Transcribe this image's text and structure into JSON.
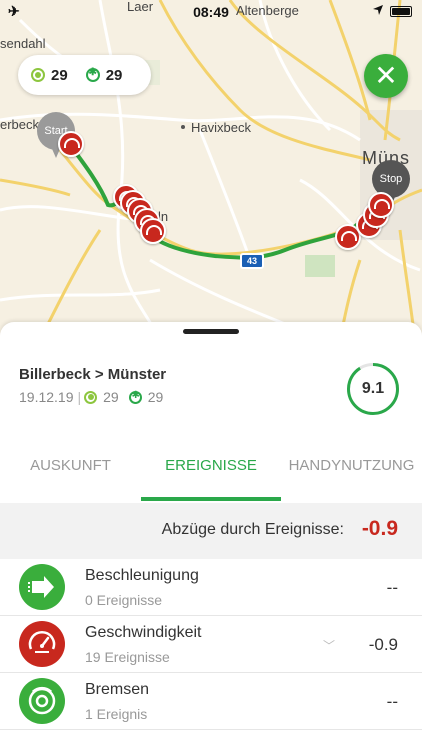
{
  "status_bar": {
    "time": "08:49"
  },
  "map": {
    "labels": {
      "laer": "Laer",
      "altenberge": "Altenberge",
      "sendahl": "sendahl",
      "erbeck": "erbeck",
      "havixbeck": "Havixbeck",
      "muenster": "Müns",
      "ln": "ln"
    },
    "score_pill": {
      "value_a": "29",
      "value_b": "29"
    },
    "start_label": "Start",
    "stop_label": "Stop",
    "highway_sign": "43"
  },
  "trip": {
    "title": "Billerbeck > Münster",
    "date": "19.12.19",
    "value_a": "29",
    "value_b": "29",
    "score": "9.1",
    "score_fraction": 0.91
  },
  "tabs": [
    {
      "label": "AUSKUNFT"
    },
    {
      "label": "EREIGNISSE"
    },
    {
      "label": "HANDYNUTZUNG"
    }
  ],
  "deductions": {
    "label": "Abzüge durch Ereignisse:",
    "value": "-0.9"
  },
  "events": [
    {
      "name": "Beschleunigung",
      "count": "0 Ereignisse",
      "value": "--"
    },
    {
      "name": "Geschwindigkeit",
      "count": "19 Ereignisse",
      "value": "-0.9"
    },
    {
      "name": "Bremsen",
      "count": "1 Ereignis",
      "value": "--"
    }
  ],
  "colors": {
    "accent_green": "#2aa84a",
    "light_green": "#8dc63f",
    "alert_red": "#c8281e",
    "route_green": "#2fa33c"
  }
}
